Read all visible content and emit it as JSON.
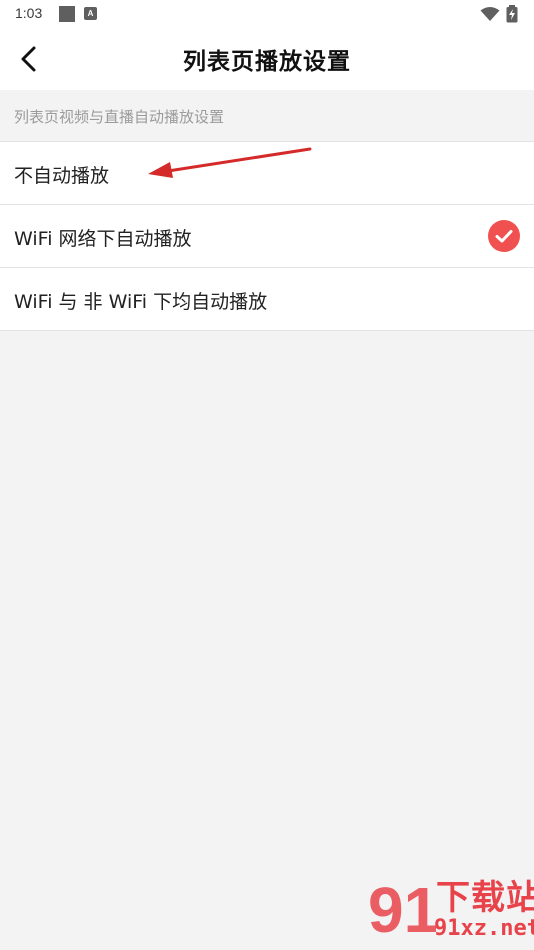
{
  "status_bar": {
    "time": "1:03",
    "icons": [
      "square-notification-icon",
      "a-notification-icon",
      "wifi-icon",
      "battery-charging-icon"
    ],
    "a_glyph": "A"
  },
  "header": {
    "back_icon": "chevron-left-icon",
    "title": "列表页播放设置"
  },
  "section": {
    "title": "列表页视频与直播自动播放设置"
  },
  "options": [
    {
      "label": "不自动播放",
      "selected": false
    },
    {
      "label": "WiFi 网络下自动播放",
      "selected": true
    },
    {
      "label": "WiFi 与 非 WiFi 下均自动播放",
      "selected": false
    }
  ],
  "colors": {
    "accent": "#f05050",
    "annotation_arrow": "#d42a2a",
    "watermark": "#e8434a"
  },
  "watermark": {
    "number": "91",
    "text": "下载站",
    "url": "91xz.net"
  }
}
